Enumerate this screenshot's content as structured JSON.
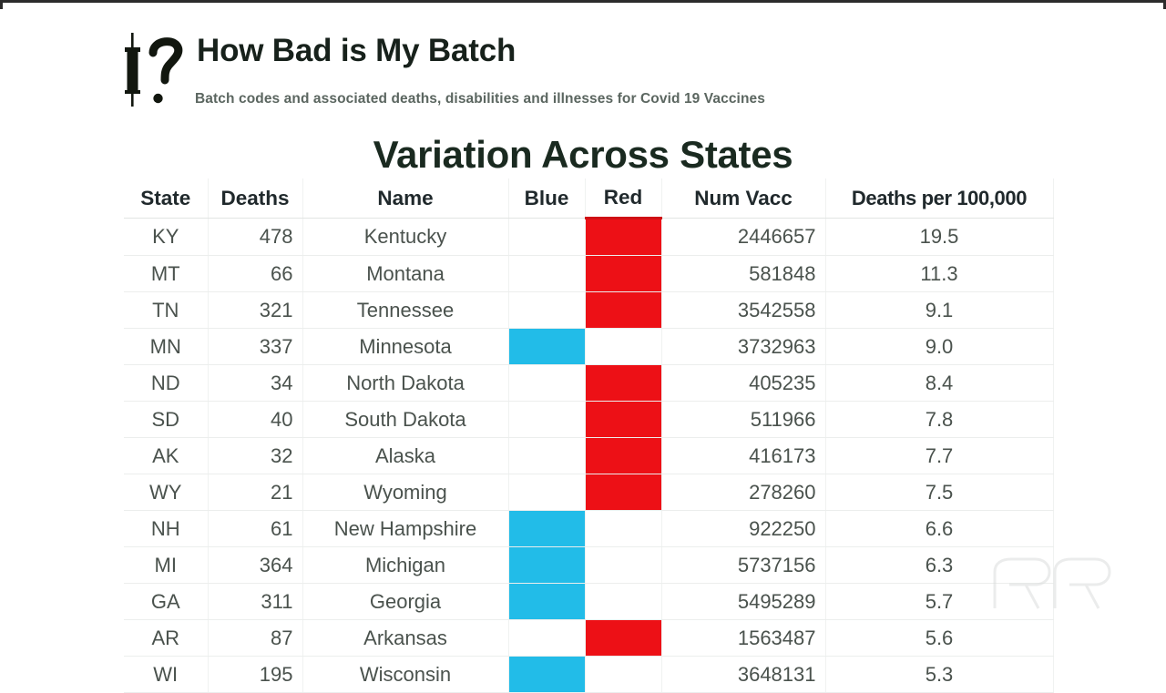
{
  "brand": {
    "logo_icon": "syringe-question-mark-icon",
    "title": "How Bad is My Batch",
    "subtitle": "Batch codes and associated deaths, disabilities and illnesses for Covid 19 Vaccines"
  },
  "slide": {
    "title": "Variation Across States"
  },
  "watermark": {
    "icon": "double-r-logo-icon"
  },
  "colors": {
    "red": "#ed1016",
    "blue": "#22bce8",
    "header_text": "#20292c",
    "body_text": "#4a524d",
    "grid_line": "#eceeed"
  },
  "chart_data": {
    "type": "table",
    "title": "Variation Across States",
    "columns": [
      "State",
      "Deaths",
      "Name",
      "Blue",
      "Red",
      "Num Vacc",
      "Deaths per 100,000"
    ],
    "rows": [
      {
        "state": "KY",
        "deaths": "478",
        "name": "Kentucky",
        "blue": false,
        "red": true,
        "num_vacc": "2446657",
        "rate": "19.5"
      },
      {
        "state": "MT",
        "deaths": "66",
        "name": "Montana",
        "blue": false,
        "red": true,
        "num_vacc": "581848",
        "rate": "11.3"
      },
      {
        "state": "TN",
        "deaths": "321",
        "name": "Tennessee",
        "blue": false,
        "red": true,
        "num_vacc": "3542558",
        "rate": "9.1"
      },
      {
        "state": "MN",
        "deaths": "337",
        "name": "Minnesota",
        "blue": true,
        "red": false,
        "num_vacc": "3732963",
        "rate": "9.0"
      },
      {
        "state": "ND",
        "deaths": "34",
        "name": "North Dakota",
        "blue": false,
        "red": true,
        "num_vacc": "405235",
        "rate": "8.4"
      },
      {
        "state": "SD",
        "deaths": "40",
        "name": "South Dakota",
        "blue": false,
        "red": true,
        "num_vacc": "511966",
        "rate": "7.8"
      },
      {
        "state": "AK",
        "deaths": "32",
        "name": "Alaska",
        "blue": false,
        "red": true,
        "num_vacc": "416173",
        "rate": "7.7"
      },
      {
        "state": "WY",
        "deaths": "21",
        "name": "Wyoming",
        "blue": false,
        "red": true,
        "num_vacc": "278260",
        "rate": "7.5"
      },
      {
        "state": "NH",
        "deaths": "61",
        "name": "New Hampshire",
        "blue": true,
        "red": false,
        "num_vacc": "922250",
        "rate": "6.6"
      },
      {
        "state": "MI",
        "deaths": "364",
        "name": "Michigan",
        "blue": true,
        "red": false,
        "num_vacc": "5737156",
        "rate": "6.3"
      },
      {
        "state": "GA",
        "deaths": "311",
        "name": "Georgia",
        "blue": true,
        "red": false,
        "num_vacc": "5495289",
        "rate": "5.7"
      },
      {
        "state": "AR",
        "deaths": "87",
        "name": "Arkansas",
        "blue": false,
        "red": true,
        "num_vacc": "1563487",
        "rate": "5.6"
      },
      {
        "state": "WI",
        "deaths": "195",
        "name": "Wisconsin",
        "blue": true,
        "red": false,
        "num_vacc": "3648131",
        "rate": "5.3"
      }
    ],
    "xlabel": "",
    "ylabel": "Deaths per 100,000",
    "note_sorted_by": "Deaths per 100,000 descending"
  }
}
